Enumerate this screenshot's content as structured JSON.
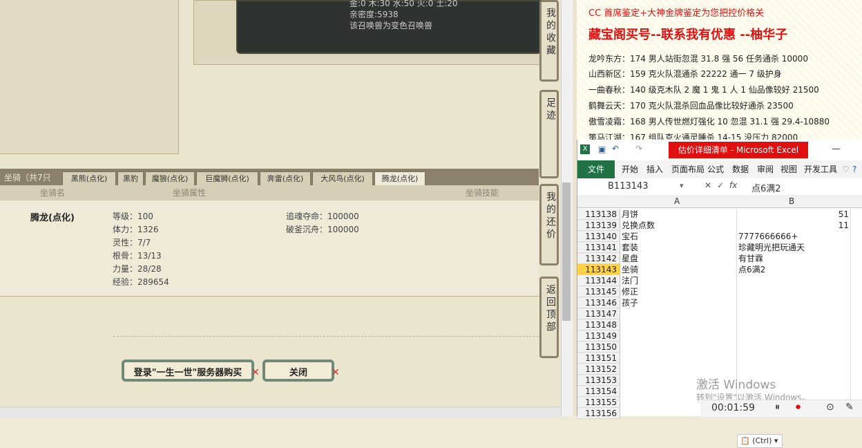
{
  "game": {
    "dark_lines": [
      "金:0 木:30 水:50 火:0 土:20",
      "亲密度:5938",
      "该召唤兽为变色召唤兽"
    ],
    "tab_title": "坐骑（共7只",
    "tabs": [
      "黑熊(点化)",
      "黑豹",
      "魔狼(点化)",
      "巨魔狮(点化)",
      "奔雷(点化)",
      "大风鸟(点化)",
      "腾龙(点化)"
    ],
    "header": {
      "name": "坐骑名",
      "attr": "坐骑属性",
      "skill": "坐骑技能"
    },
    "mount_name": "腾龙(点化)",
    "stats": [
      "等级：100",
      "体力：1326",
      "灵性：7/7",
      "根骨：13/13",
      "力量：28/28",
      "经验：289654"
    ],
    "skills": [
      "追魂夺命：100000",
      "破釜沉舟：100000"
    ],
    "buy_button": "登录\"一生一世\"服务器购买",
    "close_button": "关闭",
    "side_buttons": [
      "我的收藏",
      "足迹",
      "我的还价",
      "返回顶部"
    ]
  },
  "doc": {
    "line1": "CC 首席鉴定+大神金牌鉴定为您把控价格关",
    "line2": "藏宝阁买号--联系我有优惠 --柚华子",
    "rows": [
      "龙吟东方：174 男人站街忽混 31.8 强 56 任务通杀 10000",
      "山西新区：159 克火队混通杀 22222 通一 7 级护身",
      "一曲春秋：140 级克木队 2 魔 1 鬼 1 人 1 仙品像较好 21500",
      "鹤舞云天：170 克火队混杀回血品像比较好通杀 23500",
      "傲雪凌霜：168 男人传世燃灯强化 10 忽混 31.1 强 29.4-10880",
      "策马江湖：167 组队克火通灵睡杀 14-15 没压力 82000"
    ],
    "colors": {
      "line1": "#e01010",
      "line2": "#e01010",
      "rows": "#222222"
    }
  },
  "excel": {
    "title": "估价详细清单 - Microsoft Excel",
    "ribbon_tabs": [
      "文件",
      "开始",
      "插入",
      "页面布局",
      "公式",
      "数据",
      "审阅",
      "视图",
      "开发工具"
    ],
    "name_box": "B113143",
    "formula": "点6满2",
    "col_a": "A",
    "col_b": "B",
    "rows": [
      {
        "num": "113138",
        "a": "月饼",
        "b": "51",
        "bAlign": "right"
      },
      {
        "num": "113139",
        "a": "兑换点数",
        "b": "11",
        "bAlign": "right"
      },
      {
        "num": "113140",
        "a": "宝石",
        "b": "7777666666+",
        "bAlign": "left"
      },
      {
        "num": "113141",
        "a": "套装",
        "b": "珍藏明光把玩通天",
        "bAlign": "left"
      },
      {
        "num": "113142",
        "a": "星盘",
        "b": "有甘霖",
        "bAlign": "left"
      },
      {
        "num": "113143",
        "a": "坐骑",
        "b": "点6满2",
        "bAlign": "left",
        "selected": true
      },
      {
        "num": "113144",
        "a": "法门",
        "b": "",
        "bAlign": "left"
      },
      {
        "num": "113145",
        "a": "修正",
        "b": "",
        "bAlign": "left"
      },
      {
        "num": "113146",
        "a": "孩子",
        "b": "",
        "bAlign": "left"
      },
      {
        "num": "113147",
        "a": "",
        "b": "",
        "bAlign": "left"
      },
      {
        "num": "113148",
        "a": "",
        "b": "",
        "bAlign": "left"
      },
      {
        "num": "113149",
        "a": "",
        "b": "",
        "bAlign": "left"
      },
      {
        "num": "113150",
        "a": "",
        "b": "",
        "bAlign": "left"
      },
      {
        "num": "113151",
        "a": "",
        "b": "",
        "bAlign": "left"
      },
      {
        "num": "113152",
        "a": "",
        "b": "",
        "bAlign": "left"
      },
      {
        "num": "113153",
        "a": "",
        "b": "",
        "bAlign": "left"
      },
      {
        "num": "113154",
        "a": "",
        "b": "",
        "bAlign": "left"
      },
      {
        "num": "113155",
        "a": "",
        "b": "",
        "bAlign": "left"
      },
      {
        "num": "113156",
        "a": "",
        "b": "",
        "bAlign": "left"
      }
    ],
    "paste_label": "(Ctrl)"
  },
  "overlay": {
    "watermark1": "激活 Windows",
    "watermark2": "转到\"设置\"以激活 Windows。",
    "timer": "00:01:59"
  }
}
